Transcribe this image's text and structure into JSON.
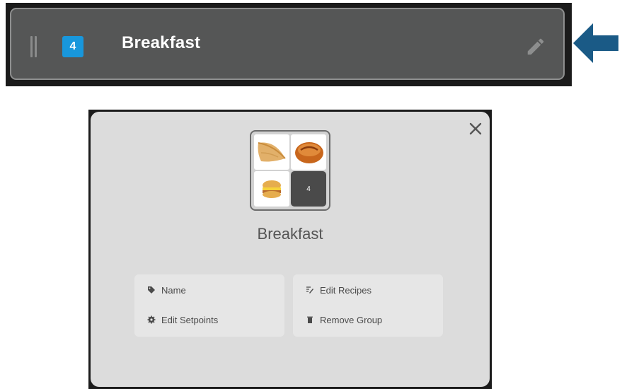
{
  "row": {
    "count": "4",
    "title": "Breakfast"
  },
  "dialog": {
    "title": "Breakfast",
    "thumbnails": [
      "crepe",
      "pastry",
      "sandwich"
    ],
    "overflow_count": "4",
    "actions": {
      "name": "Name",
      "edit_setpoints": "Edit Setpoints",
      "edit_recipes": "Edit Recipes",
      "remove_group": "Remove Group"
    }
  },
  "icons": {
    "drag": "drag-handle-icon",
    "edit": "pencil-icon",
    "close": "close-icon",
    "name": "tag-icon",
    "setpoints": "gear-icon",
    "recipes": "edit-list-icon",
    "remove": "trash-icon",
    "arrow": "arrow-left-icon"
  },
  "colors": {
    "row_background": "#555656",
    "badge": "#1897dc",
    "arrow": "#1a5a86",
    "dialog_background": "#dcdcdc"
  }
}
